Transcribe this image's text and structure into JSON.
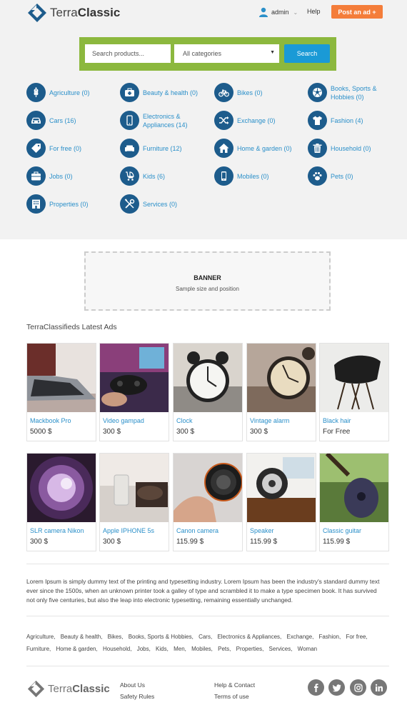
{
  "header": {
    "logo_light": "Terra",
    "logo_bold": "Classic",
    "user_name": "admin",
    "help_label": "Help",
    "post_ad_label": "Post an ad +"
  },
  "search": {
    "placeholder": "Search products...",
    "category_value": "All categories",
    "button_label": "Search"
  },
  "categories": [
    {
      "label": "Agriculture (0)",
      "icon": "wheat-icon"
    },
    {
      "label": "Beauty & health (0)",
      "icon": "first-aid-icon"
    },
    {
      "label": "Bikes (0)",
      "icon": "bicycle-icon"
    },
    {
      "label": "Books, Sports & Hobbies (0)",
      "icon": "soccer-ball-icon"
    },
    {
      "label": "Cars (16)",
      "icon": "car-icon"
    },
    {
      "label": "Electronics & Appliances (14)",
      "icon": "phone-icon"
    },
    {
      "label": "Exchange (0)",
      "icon": "shuffle-icon"
    },
    {
      "label": "Fashion (4)",
      "icon": "tshirt-icon"
    },
    {
      "label": "For free (0)",
      "icon": "tag-icon"
    },
    {
      "label": "Furniture (12)",
      "icon": "sofa-icon"
    },
    {
      "label": "Home & garden (0)",
      "icon": "home-icon"
    },
    {
      "label": "Household (0)",
      "icon": "trash-icon"
    },
    {
      "label": "Jobs (0)",
      "icon": "briefcase-icon"
    },
    {
      "label": "Kids (6)",
      "icon": "stroller-icon"
    },
    {
      "label": "Mobiles (0)",
      "icon": "mobile-icon"
    },
    {
      "label": "Pets (0)",
      "icon": "paw-icon"
    },
    {
      "label": "Properties (0)",
      "icon": "building-icon"
    },
    {
      "label": "Services (0)",
      "icon": "tools-icon"
    }
  ],
  "banner": {
    "title": "BANNER",
    "subtitle": "Sample size and position"
  },
  "latest": {
    "title": "TerraClassifieds Latest Ads",
    "ads": [
      {
        "title": "Mackbook Pro",
        "price": "5000 $"
      },
      {
        "title": "Video gampad",
        "price": "300 $"
      },
      {
        "title": "Clock",
        "price": "300 $"
      },
      {
        "title": "Vintage alarm",
        "price": "300 $"
      },
      {
        "title": "Black hair",
        "price": "For Free"
      },
      {
        "title": "SLR camera Nikon",
        "price": "300 $"
      },
      {
        "title": "Apple IPHONE 5s",
        "price": "300 $"
      },
      {
        "title": "Canon camera",
        "price": "115.99 $"
      },
      {
        "title": "Speaker",
        "price": "115.99 $"
      },
      {
        "title": "Classic guitar",
        "price": "115.99 $"
      }
    ]
  },
  "description": "Lorem Ipsum is simply dummy text of the printing and typesetting industry. Lorem Ipsum has been the industry's standard dummy text ever since the 1500s, when an unknown printer took a galley of type and scrambled it to make a type specimen book. It has survived not only five centuries, but also the leap into electronic typesetting, remaining essentially unchanged.",
  "tags": [
    "Agriculture,",
    "Beauty & health,",
    "Bikes,",
    "Books, Sports & Hobbies,",
    "Cars,",
    "Electronics & Appliances,",
    "Exchange,",
    "Fashion,",
    "For free,",
    "Furniture,",
    "Home & garden,",
    "Household,",
    "Jobs,",
    "Kids,",
    "Men,",
    "Mobiles,",
    "Pets,",
    "Properties,",
    "Services,",
    "Woman"
  ],
  "footer": {
    "logo_light": "Terra",
    "logo_bold": "Classic",
    "about": "About Us",
    "safety": "Safety Rules",
    "help_contact": "Help & Contact",
    "terms": "Terms of use"
  },
  "colors": {
    "accent_blue": "#2a8fc9",
    "icon_navy": "#1d5c8c",
    "search_green": "#8cb83e",
    "post_orange": "#f47d3a"
  }
}
